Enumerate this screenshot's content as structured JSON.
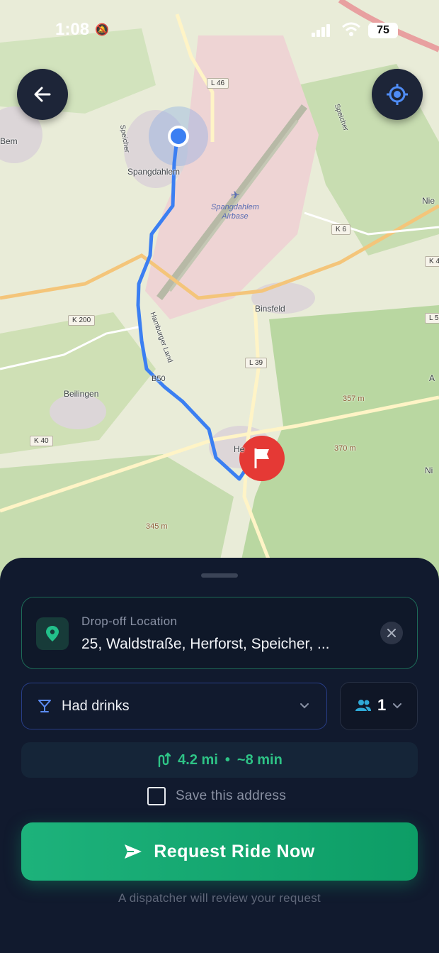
{
  "status_bar": {
    "time": "1:08",
    "battery": "75"
  },
  "map": {
    "places": [
      "Spangdahlem",
      "Binsfeld",
      "Beilingen",
      "Bem",
      "Nie",
      "Ni",
      "A",
      "He"
    ],
    "airbase_label": [
      "Spangdahlem",
      "Airbase"
    ],
    "roads": [
      "L 46",
      "K 6",
      "K 200",
      "L 39",
      "K 40",
      "K 4",
      "L 5",
      "B50",
      "Speicher",
      "Speicher",
      "Hamburger Land"
    ],
    "elevations": [
      "357 m",
      "370 m",
      "345 m"
    ]
  },
  "dropoff": {
    "label": "Drop-off Location",
    "address": "25, Waldstraße, Herforst, Speicher, ..."
  },
  "ride_reason": {
    "selected": "Had drinks"
  },
  "passengers": {
    "count": "1"
  },
  "estimate": {
    "distance": "4.2 mi",
    "separator": "•",
    "duration": "~8 min"
  },
  "save_address": {
    "label": "Save this address",
    "checked": false
  },
  "request_button": {
    "label": "Request Ride Now"
  },
  "footer_note": "A dispatcher will review your request",
  "colors": {
    "accent_green": "#1db27b",
    "route_blue": "#3b7ff2",
    "destination_red": "#e53935",
    "sheet_bg": "#111a2e"
  }
}
